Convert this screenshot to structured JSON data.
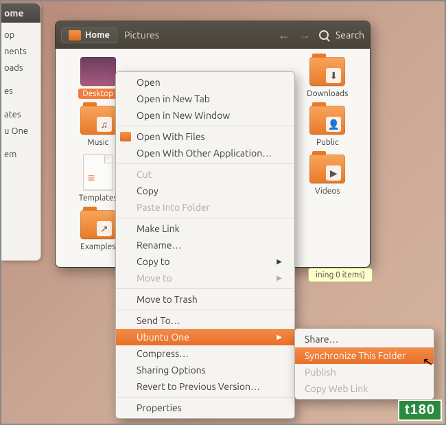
{
  "sidebar": {
    "title": "ome",
    "items": [
      "op",
      "nents",
      "oads",
      "es",
      "ates",
      "u One",
      "em"
    ]
  },
  "toolbar": {
    "home_label": "Home",
    "crumb": "Pictures",
    "search_label": "Search"
  },
  "files": [
    {
      "label": "Desktop",
      "kind": "desktop",
      "selected": true
    },
    {
      "label": "",
      "kind": "folder-plain"
    },
    {
      "label": "Downloads",
      "kind": "folder",
      "badge": "↓"
    },
    {
      "label": "Music",
      "kind": "folder",
      "badge": "♫"
    },
    {
      "label": "",
      "kind": "folder-plain"
    },
    {
      "label": "Public",
      "kind": "folder",
      "badge": "👤"
    },
    {
      "label": "Templates",
      "kind": "file"
    },
    {
      "label": "",
      "kind": "folder-plain"
    },
    {
      "label": "Videos",
      "kind": "folder",
      "badge": "▶"
    },
    {
      "label": "Examples",
      "kind": "folder-link"
    }
  ],
  "status": "ining 0 items)",
  "ctx": {
    "open": "Open",
    "open_tab": "Open in New Tab",
    "open_win": "Open in New Window",
    "open_files": "Open With Files",
    "open_other": "Open With Other Application…",
    "cut": "Cut",
    "copy": "Copy",
    "paste": "Paste Into Folder",
    "make_link": "Make Link",
    "rename": "Rename…",
    "copy_to": "Copy to",
    "move_to": "Move to",
    "trash": "Move to Trash",
    "send_to": "Send To…",
    "ubuntu_one": "Ubuntu One",
    "compress": "Compress…",
    "sharing": "Sharing Options",
    "revert": "Revert to Previous Version…",
    "properties": "Properties"
  },
  "sub": {
    "share": "Share…",
    "sync": "Synchronize This Folder",
    "publish": "Publish",
    "copy_link": "Copy Web Link"
  },
  "logo": "t180"
}
